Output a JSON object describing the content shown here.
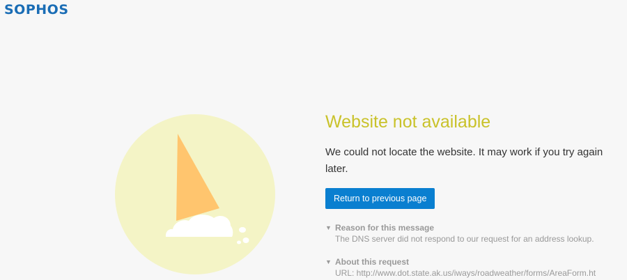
{
  "brand": {
    "logo_text": "SOPHOS",
    "color": "#1a6db5"
  },
  "error": {
    "title": "Website not available",
    "message": "We could not locate the website. It may work if you try again later.",
    "return_label": "Return to previous page"
  },
  "details": [
    {
      "heading": "Reason for this message",
      "body": "The DNS server did not respond to our request for an address lookup.",
      "icon": "chevron-down-icon"
    },
    {
      "heading": "About this request",
      "body": "URL: http://www.dot.state.ak.us/iways/roadweather/forms/AreaForm.ht",
      "icon": "chevron-down-icon"
    }
  ],
  "illustration": {
    "icon": "dropped-ice-cream-cone-icon"
  },
  "colors": {
    "title": "#c9c22a",
    "button": "#0a7fd0",
    "circle": "#f4f4c6",
    "cone": "#ffc56e",
    "muted_text": "#999999"
  }
}
